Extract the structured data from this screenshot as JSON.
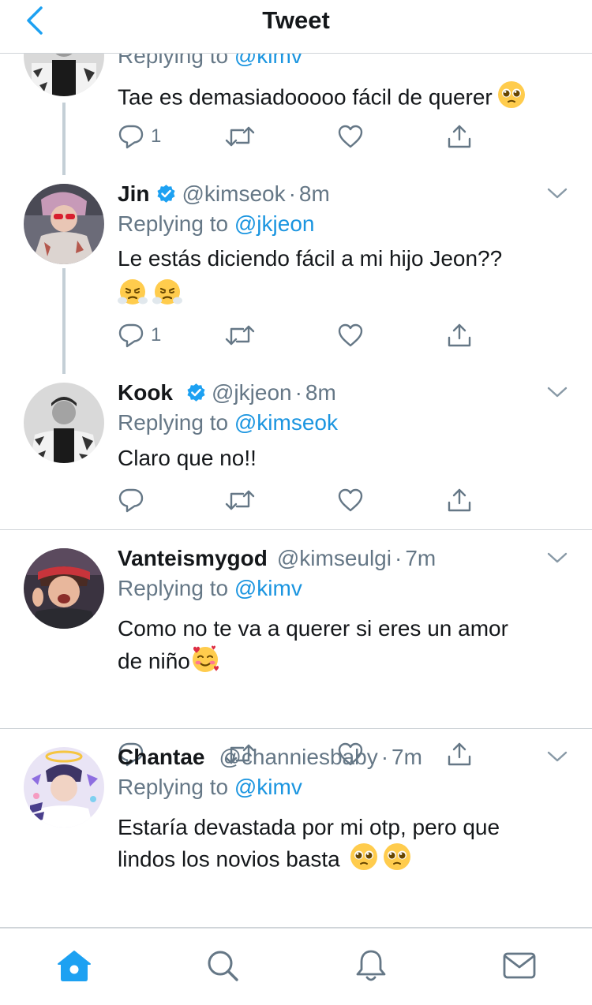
{
  "header": {
    "title": "Tweet"
  },
  "colors": {
    "accent": "#1da1f2",
    "mention": "#1b95e0",
    "muted": "#657786",
    "thread_line": "#c4cfd6"
  },
  "tweets": [
    {
      "replying_prefix": "Replying to",
      "replying_to": "@kimv",
      "text": "Tae es demasiadooooo fácil de querer",
      "emojis": [
        "pleading-face"
      ],
      "reply_count": "1"
    },
    {
      "name": "Jin",
      "verified": true,
      "handle": "@kimseok",
      "dot": "·",
      "time": "8m",
      "replying_prefix": "Replying to",
      "replying_to": "@jkjeon",
      "text": "Le estás diciendo fácil a mi hijo Jeon??",
      "emojis": [
        "face-with-steam",
        "face-with-steam"
      ],
      "reply_count": "1"
    },
    {
      "name": "Kook",
      "verified": true,
      "handle": "@jkjeon",
      "dot": "·",
      "time": "8m",
      "replying_prefix": "Replying to",
      "replying_to": "@kimseok",
      "text": "Claro que no!!",
      "reply_count": ""
    },
    {
      "name": "Vanteismygod",
      "verified": false,
      "handle": "@kimseulgi",
      "dot": "·",
      "time": "7m",
      "replying_prefix": "Replying to",
      "replying_to": "@kimv",
      "text_line1": "Como no te va a querer si eres un amor",
      "text_line2": "de niño",
      "emojis": [
        "smiling-face-with-hearts"
      ],
      "reply_count": ""
    },
    {
      "name": "Chantae",
      "verified": false,
      "handle": "@channiesbaby",
      "dot": "·",
      "time": "7m",
      "replying_prefix": "Replying to",
      "replying_to": "@kimv",
      "text_line1": "Estaría devastada por mi otp, pero que",
      "text_line2": "lindos los novios basta",
      "emojis": [
        "pleading-face",
        "pleading-face"
      ],
      "reply_count": ""
    }
  ],
  "tabbar": {
    "items": [
      "home-icon",
      "search-icon",
      "notifications-icon",
      "messages-icon"
    ],
    "active": "home-icon"
  }
}
